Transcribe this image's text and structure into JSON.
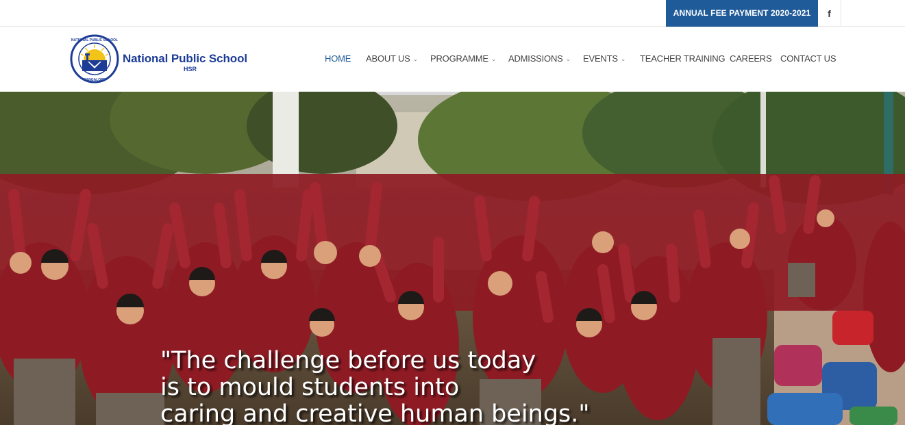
{
  "topbar": {
    "fee_button_label": "ANNUAL FEE PAYMENT 2020-2021",
    "facebook_glyph": "f"
  },
  "logo": {
    "name": "National Public School",
    "sub": "HSR",
    "seal_top": "NATIONAL PUBLIC SCHOOL",
    "seal_bottom": "BANGALORE"
  },
  "nav": {
    "items": [
      {
        "label": "HOME",
        "active": true
      },
      {
        "label": "ABOUT US",
        "dropdown": true
      },
      {
        "label": "PROGRAMME",
        "dropdown": true
      },
      {
        "label": "ADMISSIONS",
        "dropdown": true
      },
      {
        "label": "EVENTS",
        "dropdown": true
      },
      {
        "label": "TEACHER TRAINING"
      },
      {
        "label": "CAREERS"
      },
      {
        "label": "CONTACT US"
      }
    ],
    "dropdown_glyph": "⌄"
  },
  "hero": {
    "quote_lines": [
      "\"The challenge before us today",
      "is to mould students into",
      "caring and creative human beings.\""
    ]
  },
  "colors": {
    "brand_blue": "#1f5b99",
    "logo_blue": "#1c3c96",
    "uniform_maroon": "#8e1b24"
  }
}
